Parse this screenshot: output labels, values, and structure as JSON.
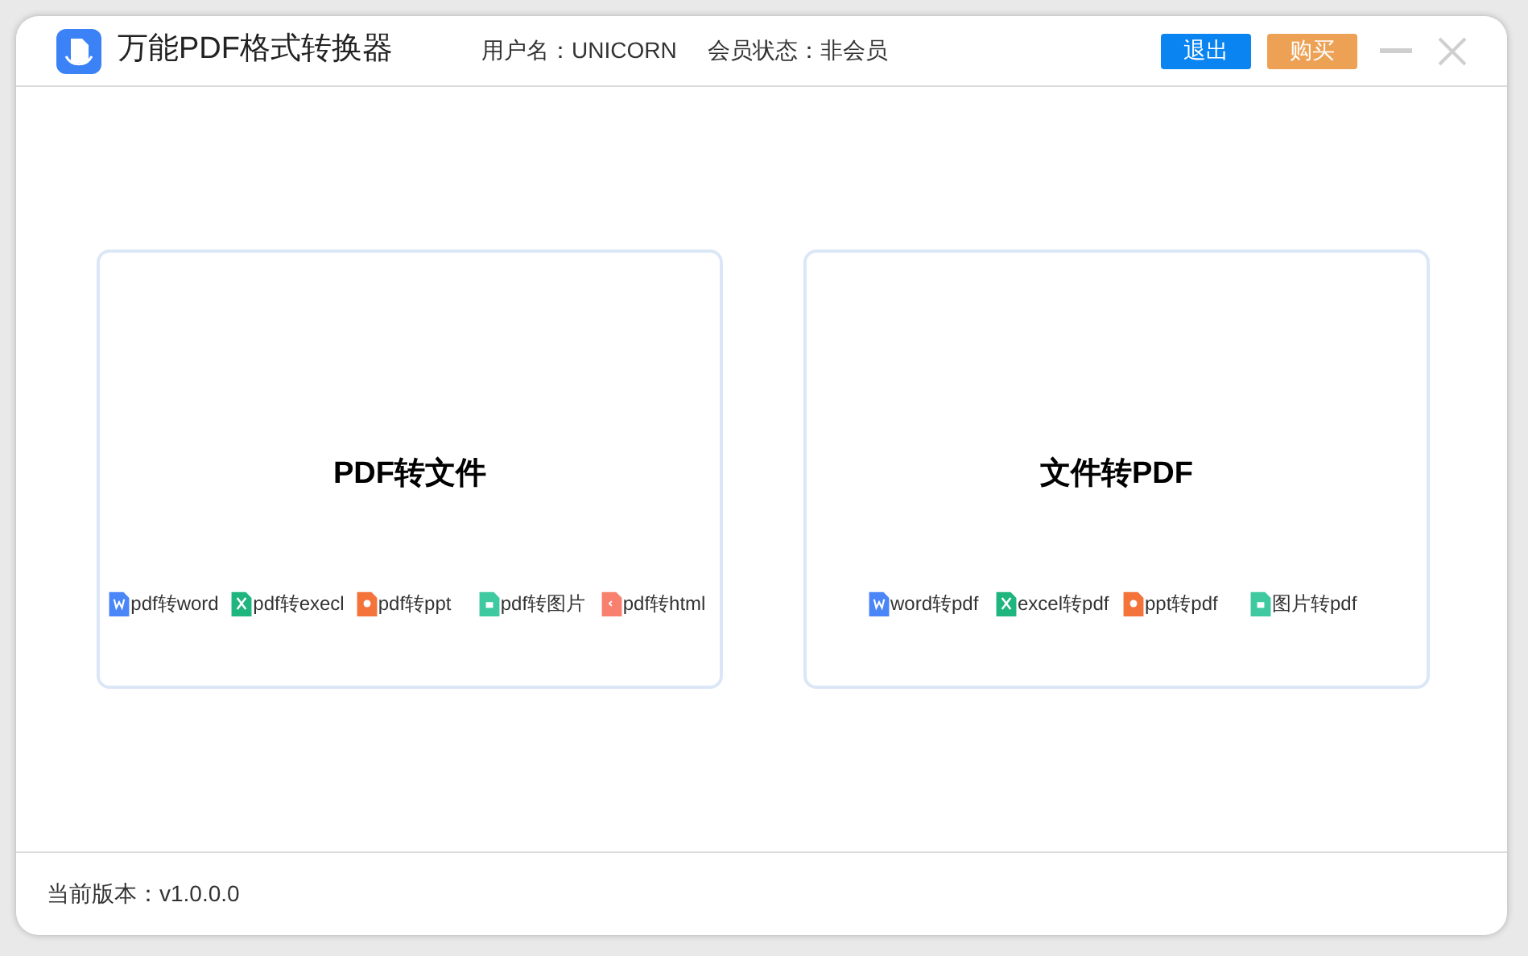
{
  "window": {
    "title": "万能PDF格式转换器",
    "user_label": "用户名：UNICORN",
    "member_label": "会员状态：非会员"
  },
  "buttons": [
    {
      "label": "退出",
      "kind": "logout"
    },
    {
      "label": "购买",
      "kind": "buy"
    }
  ],
  "cards": [
    {
      "title": "PDF转文件",
      "links": [
        {
          "label": "pdf转word",
          "kind": "word"
        },
        {
          "label": "pdf转execl",
          "kind": "excel"
        },
        {
          "label": "pdf转ppt",
          "kind": "ppt"
        },
        {
          "label": "pdf转图片",
          "kind": "image"
        },
        {
          "label": "pdf转html",
          "kind": "html"
        }
      ]
    },
    {
      "title": "文件转PDF",
      "links": [
        {
          "label": "word转pdf",
          "kind": "word"
        },
        {
          "label": "excel转pdf",
          "kind": "excel"
        },
        {
          "label": "ppt转pdf",
          "kind": "ppt"
        },
        {
          "label": "图片转pdf",
          "kind": "image"
        }
      ]
    }
  ],
  "status_bar": {
    "version": "当前版本：v1.0.0.0"
  }
}
